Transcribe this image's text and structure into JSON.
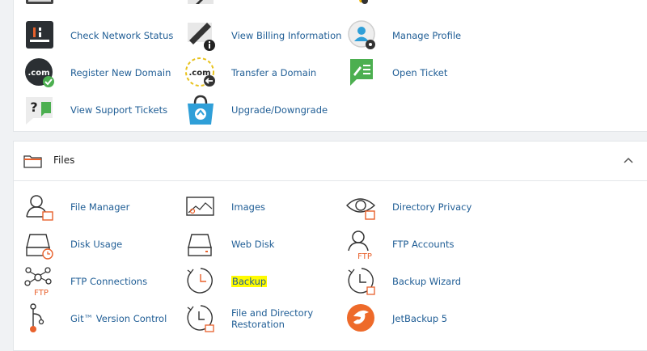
{
  "general": {
    "items": [
      {
        "label": "Check Network Status",
        "icon": "network-status-icon"
      },
      {
        "label": "View Billing Information",
        "icon": "billing-info-icon"
      },
      {
        "label": "Manage Profile",
        "icon": "profile-icon"
      },
      {
        "label": "Register New Domain",
        "icon": "register-domain-icon"
      },
      {
        "label": "Transfer a Domain",
        "icon": "transfer-domain-icon"
      },
      {
        "label": "Open Ticket",
        "icon": "open-ticket-icon"
      },
      {
        "label": "View Support Tickets",
        "icon": "support-tickets-icon"
      },
      {
        "label": "Upgrade/Downgrade",
        "icon": "upgrade-downgrade-icon"
      }
    ],
    "dot_com_text": ".com"
  },
  "files": {
    "title": "Files",
    "ftp_badge": "FTP",
    "items": [
      {
        "label": "File Manager",
        "icon": "file-manager-icon"
      },
      {
        "label": "Images",
        "icon": "images-icon"
      },
      {
        "label": "Directory Privacy",
        "icon": "directory-privacy-icon"
      },
      {
        "label": "Disk Usage",
        "icon": "disk-usage-icon"
      },
      {
        "label": "Web Disk",
        "icon": "web-disk-icon"
      },
      {
        "label": "FTP Accounts",
        "icon": "ftp-accounts-icon"
      },
      {
        "label": "FTP Connections",
        "icon": "ftp-connections-icon"
      },
      {
        "label": "Backup",
        "icon": "backup-icon",
        "highlighted": true
      },
      {
        "label": "Backup Wizard",
        "icon": "backup-wizard-icon"
      },
      {
        "label": "Git™ Version Control",
        "icon": "git-icon"
      },
      {
        "label": "File and Directory Restoration",
        "icon": "restoration-icon"
      },
      {
        "label": "JetBackup 5",
        "icon": "jetbackup-icon"
      }
    ]
  },
  "colors": {
    "link": "#1f5d95",
    "accent_orange": "#e8612c",
    "highlight": "#fffb00",
    "green": "#4caf50",
    "blue": "#2f9fd8"
  }
}
